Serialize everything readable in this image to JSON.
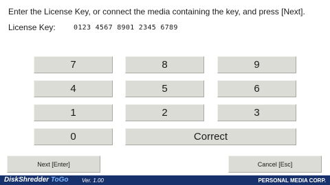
{
  "instruction": "Enter the License Key, or connect the media containing the key, and press [Next].",
  "license": {
    "label": "License Key:",
    "value": "0123 4567 8901 2345 6789"
  },
  "keypad": {
    "k7": "7",
    "k8": "8",
    "k9": "9",
    "k4": "4",
    "k5": "5",
    "k6": "6",
    "k1": "1",
    "k2": "2",
    "k3": "3",
    "k0": "0",
    "correct": "Correct"
  },
  "buttons": {
    "next": "Next [Enter]",
    "cancel": "Cancel [Esc]"
  },
  "footer": {
    "product_main": "DiskShredder ",
    "product_suffix": "ToGo",
    "version": "Ver. 1.00",
    "company": "PERSONAL MEDIA CORP."
  },
  "colors": {
    "footer_bg": "#16316b",
    "button_face": "#dcdcd6",
    "togo_accent": "#7fb5ff"
  }
}
